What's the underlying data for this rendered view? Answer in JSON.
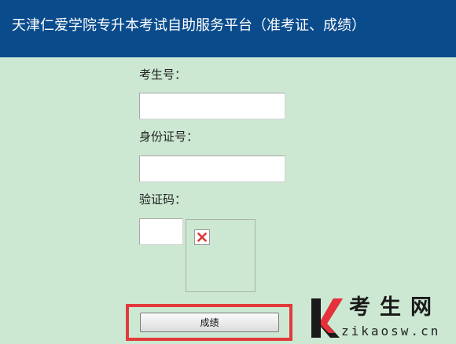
{
  "header": {
    "title": "天津仁爱学院专升本考试自助服务平台（准考证、成绩）"
  },
  "form": {
    "exam_number_label": "考生号：",
    "id_number_label": "身份证号：",
    "captcha_label": "验证码：",
    "exam_number_value": "",
    "id_number_value": "",
    "captcha_value": "",
    "submit_label": "成绩"
  },
  "watermark": {
    "logo_letter": "K",
    "name": "考生网",
    "domain": "zikaosw.cn"
  },
  "colors": {
    "header_bg": "#0a4b8c",
    "page_bg": "#cce8d2",
    "highlight": "#e23a3a",
    "logo_red": "#e8303a",
    "broken_icon": "#d93a3a"
  },
  "icons": {
    "captcha_image": "broken-image-icon",
    "logo": "k-logo"
  }
}
